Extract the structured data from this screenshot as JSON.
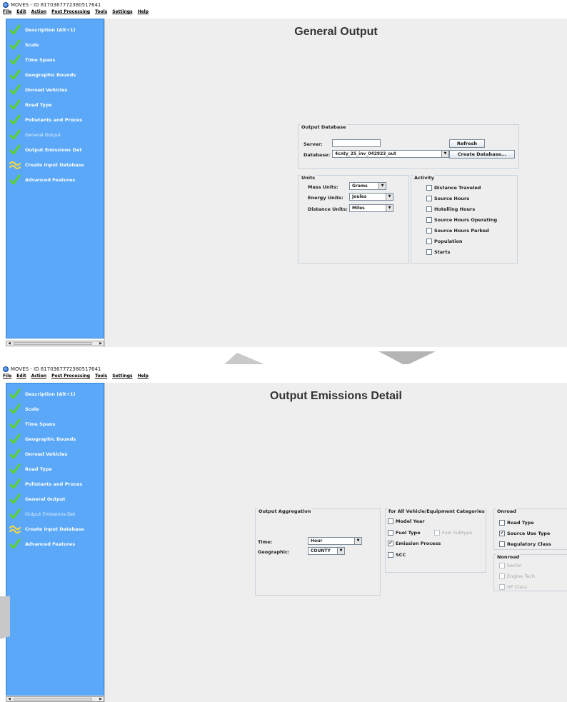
{
  "window_title": "MOVES - ID 8170367772380517641",
  "menu": [
    "File",
    "Edit",
    "Action",
    "Post Processing",
    "Tools",
    "Settings",
    "Help"
  ],
  "nav_items": [
    {
      "label": "Description (Alt+1)",
      "icon": "check-icon"
    },
    {
      "label": "Scale",
      "icon": "check-icon"
    },
    {
      "label": "Time Spans",
      "icon": "check-icon"
    },
    {
      "label": "Geographic Bounds",
      "icon": "check-icon"
    },
    {
      "label": "Onroad Vehicles",
      "icon": "check-icon"
    },
    {
      "label": "Road Type",
      "icon": "check-icon"
    },
    {
      "label": "Pollutants and Proces",
      "icon": "check-icon"
    },
    {
      "label": "General Output",
      "icon": "check-icon"
    },
    {
      "label": "Output Emissions Det",
      "icon": "check-icon"
    },
    {
      "label": "Create Input Database",
      "icon": "wave-icon"
    },
    {
      "label": "Advanced Features",
      "icon": "check-icon"
    }
  ],
  "top": {
    "title": "General Output",
    "active_nav": "General Output",
    "output_database": {
      "group_title": "Output Database",
      "server_label": "Server:",
      "server_value": "",
      "refresh_button": "Refresh",
      "database_label": "Database:",
      "database_value": "4cnty_25_inv_042923_out",
      "create_button": "Create Database..."
    },
    "units": {
      "group_title": "Units",
      "mass_label": "Mass Units:",
      "mass_value": "Grams",
      "energy_label": "Energy Units:",
      "energy_value": "Joules",
      "distance_label": "Distance Units:",
      "distance_value": "Miles"
    },
    "activity": {
      "group_title": "Activity",
      "items": [
        {
          "label": "Distance Traveled",
          "checked": false
        },
        {
          "label": "Source Hours",
          "checked": false
        },
        {
          "label": "Hotelling Hours",
          "checked": false
        },
        {
          "label": "Source Hours Operating",
          "checked": false
        },
        {
          "label": "Source Hours Parked",
          "checked": false
        },
        {
          "label": "Population",
          "checked": false
        },
        {
          "label": "Starts",
          "checked": false
        }
      ]
    }
  },
  "bottom": {
    "title": "Output Emissions Detail",
    "active_nav": "Output Emissions Det",
    "aggregation": {
      "group_title": "Output Aggregation",
      "time_label": "Time:",
      "time_value": "Hour",
      "geo_label": "Geographic:",
      "geo_value": "COUNTY"
    },
    "all_categories": {
      "group_title": "for All Vehicle/Equipment Categories",
      "model_year": {
        "label": "Model Year",
        "checked": false
      },
      "fuel_type": {
        "label": "Fuel Type",
        "checked": false
      },
      "fuel_subtype": {
        "label": "Fuel Subtype",
        "checked": false
      },
      "emission_process": {
        "label": "Emission Process",
        "checked": true
      },
      "scc": {
        "label": "SCC",
        "checked": false
      }
    },
    "onroad": {
      "group_title": "Onroad",
      "road_type": {
        "label": "Road Type",
        "checked": false
      },
      "source_use_type": {
        "label": "Source Use Type",
        "checked": true
      },
      "regulatory_class": {
        "label": "Regulatory Class",
        "checked": false
      }
    },
    "nonroad": {
      "group_title": "Nonroad",
      "sector": {
        "label": "Sector",
        "checked": false
      },
      "engine_tech": {
        "label": "Engine Tech.",
        "checked": false
      },
      "hp_class": {
        "label": "HP Class",
        "checked": false
      }
    }
  },
  "colors": {
    "sidebar": "#5aa8f7",
    "check": "#5bd42c",
    "panel": "#eeeeee"
  }
}
